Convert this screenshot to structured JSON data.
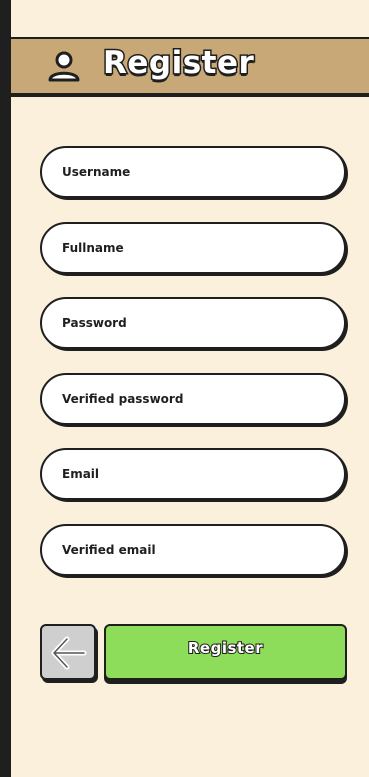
{
  "header": {
    "title": "Register",
    "icon": "user-icon"
  },
  "form": {
    "fields": [
      {
        "name": "username",
        "placeholder": "Username",
        "value": ""
      },
      {
        "name": "fullname",
        "placeholder": "Fullname",
        "value": ""
      },
      {
        "name": "password",
        "placeholder": "Password",
        "value": ""
      },
      {
        "name": "verified-password",
        "placeholder": "Verified password",
        "value": ""
      },
      {
        "name": "email",
        "placeholder": "Email",
        "value": ""
      },
      {
        "name": "verified-email",
        "placeholder": "Verified email",
        "value": ""
      }
    ]
  },
  "actions": {
    "back_icon": "arrow-left-icon",
    "register_label": "Register"
  },
  "colors": {
    "background": "#faf0dc",
    "header": "#c9a877",
    "register_button": "#8ddc5a",
    "back_button": "#cfcfcf",
    "outline": "#1f1f1f"
  }
}
